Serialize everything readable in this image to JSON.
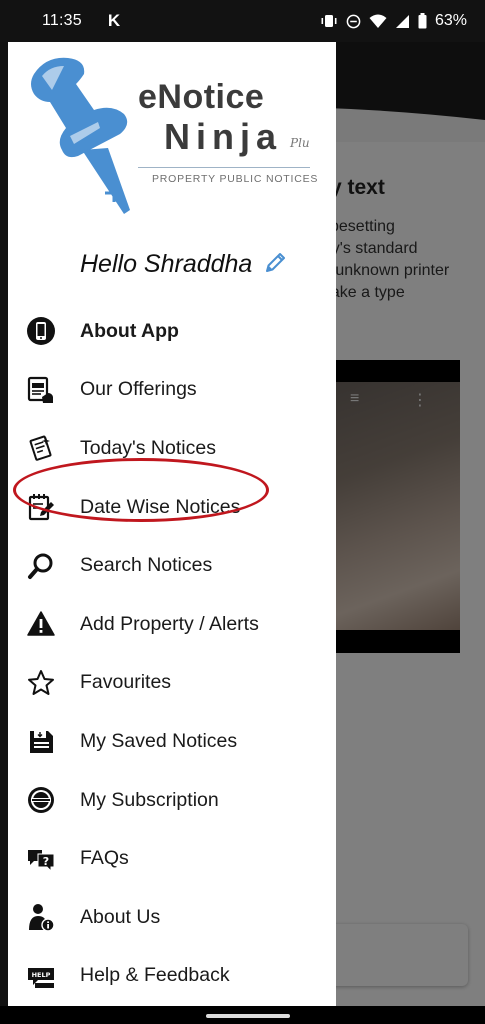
{
  "status_bar": {
    "time": "11:35",
    "app_icon_letter": "K",
    "battery": "63%"
  },
  "background": {
    "title_fragment": "y text",
    "paragraph_fragment": "ypesetting\ntry's standard\nn unknown printer\nnake a type"
  },
  "drawer": {
    "logo": {
      "brand_line1": "eNotice",
      "brand_line2": "Ninja",
      "brand_suffix": "Plu",
      "tagline": "PROPERTY PUBLIC NOTICES"
    },
    "greeting": "Hello Shraddha",
    "items": [
      {
        "label": "About App",
        "icon": "phone-app-icon"
      },
      {
        "label": "Our Offerings",
        "icon": "offerings-icon"
      },
      {
        "label": "Today's Notices",
        "icon": "todays-notices-icon"
      },
      {
        "label": "Date Wise Notices",
        "icon": "date-notepad-icon"
      },
      {
        "label": "Search Notices",
        "icon": "search-icon"
      },
      {
        "label": "Add Property / Alerts",
        "icon": "alert-icon"
      },
      {
        "label": "Favourites",
        "icon": "star-icon"
      },
      {
        "label": "My Saved Notices",
        "icon": "save-icon"
      },
      {
        "label": "My Subscription",
        "icon": "subscription-badge-icon"
      },
      {
        "label": "FAQs",
        "icon": "faq-icon"
      },
      {
        "label": "About Us",
        "icon": "person-info-icon"
      },
      {
        "label": "Help & Feedback",
        "icon": "help-icon"
      }
    ]
  },
  "colors": {
    "brand_blue": "#4a8fd1",
    "highlight_red": "#c0171e"
  }
}
